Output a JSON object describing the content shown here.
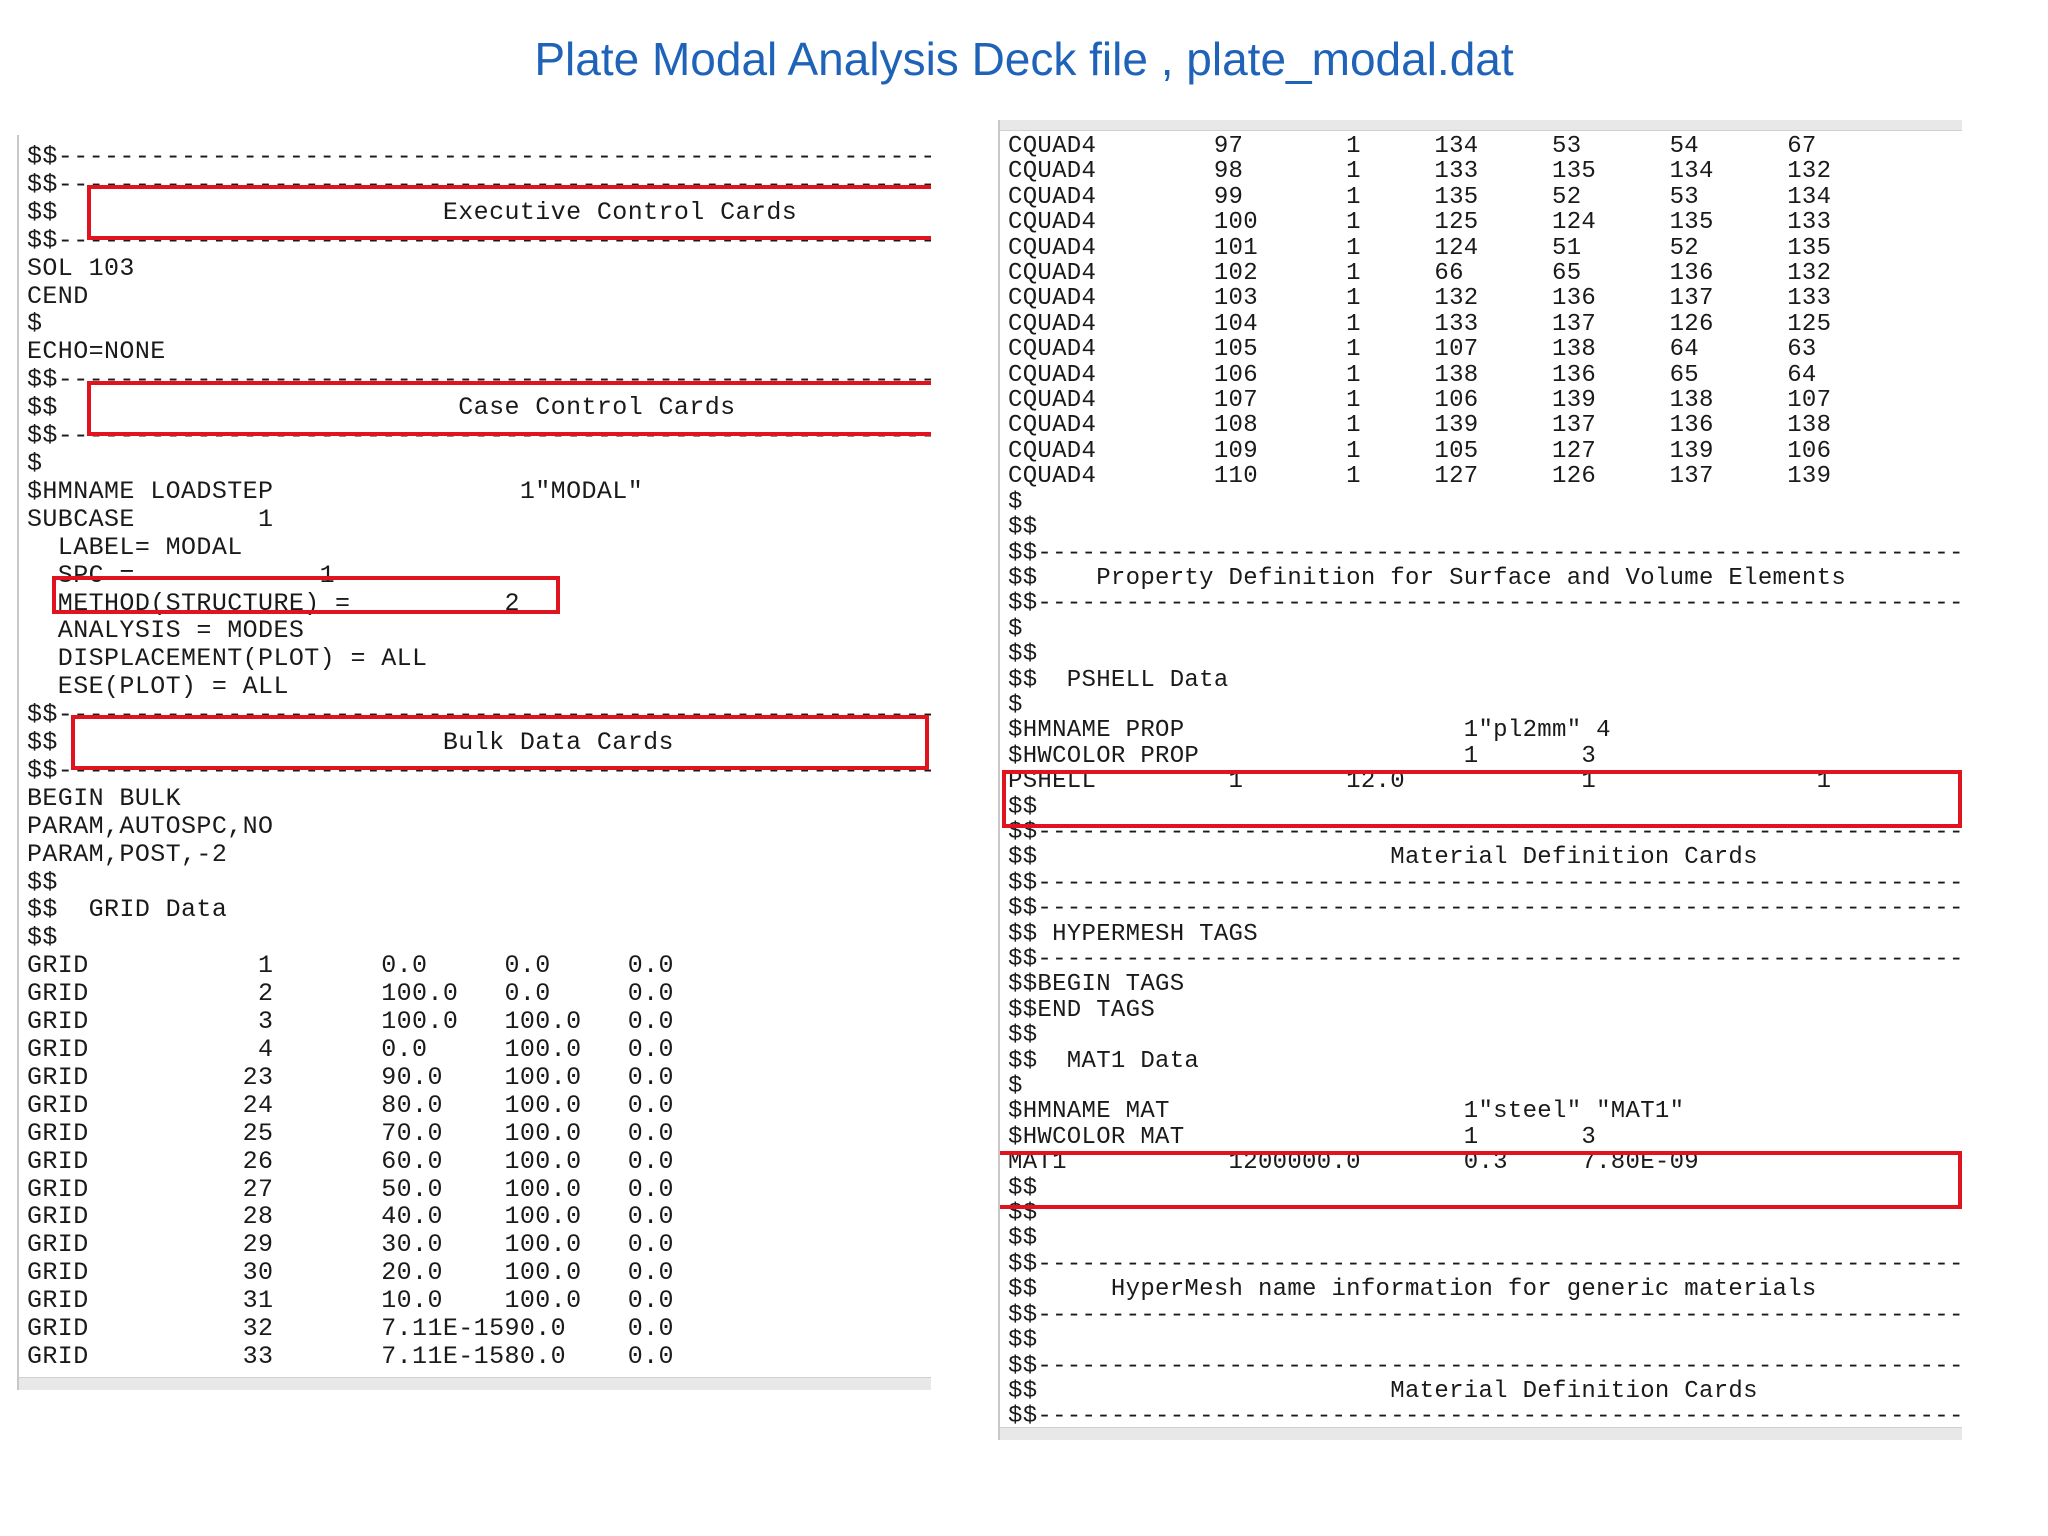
{
  "title": "Plate Modal Analysis Deck file , plate_modal.dat",
  "left_lines": [
    "$$------------------------------------------------------------------------",
    "$$------------------------------------------------------------------------",
    "$$                         Executive Control Cards",
    "$$------------------------------------------------------------------------",
    "SOL 103",
    "CEND",
    "$",
    "ECHO=NONE",
    "$$------------------------------------------------------------------------",
    "$$                          Case Control Cards",
    "$$------------------------------------------------------------------------",
    "$",
    "$HMNAME LOADSTEP                1\"MODAL\"",
    "SUBCASE        1",
    "  LABEL= MODAL",
    "  SPC =            1",
    "  METHOD(STRUCTURE) =          2",
    "  ANALYSIS = MODES",
    "  DISPLACEMENT(PLOT) = ALL",
    "  ESE(PLOT) = ALL",
    "$$------------------------------------------------------------------------",
    "$$                         Bulk Data Cards",
    "$$------------------------------------------------------------------------",
    "BEGIN BULK",
    "PARAM,AUTOSPC,NO",
    "PARAM,POST,-2",
    "$$",
    "$$  GRID Data",
    "$$",
    "GRID           1       0.0     0.0     0.0",
    "GRID           2       100.0   0.0     0.0",
    "GRID           3       100.0   100.0   0.0",
    "GRID           4       0.0     100.0   0.0",
    "GRID          23       90.0    100.0   0.0",
    "GRID          24       80.0    100.0   0.0",
    "GRID          25       70.0    100.0   0.0",
    "GRID          26       60.0    100.0   0.0",
    "GRID          27       50.0    100.0   0.0",
    "GRID          28       40.0    100.0   0.0",
    "GRID          29       30.0    100.0   0.0",
    "GRID          30       20.0    100.0   0.0",
    "GRID          31       10.0    100.0   0.0",
    "GRID          32       7.11E-1590.0    0.0",
    "GRID          33       7.11E-1580.0    0.0"
  ],
  "right_lines": [
    "CQUAD4        97       1     134     53      54      67",
    "CQUAD4        98       1     133     135     134     132",
    "CQUAD4        99       1     135     52      53      134",
    "CQUAD4        100      1     125     124     135     133",
    "CQUAD4        101      1     124     51      52      135",
    "CQUAD4        102      1     66      65      136     132",
    "CQUAD4        103      1     132     136     137     133",
    "CQUAD4        104      1     133     137     126     125",
    "CQUAD4        105      1     107     138     64      63",
    "CQUAD4        106      1     138     136     65      64",
    "CQUAD4        107      1     106     139     138     107",
    "CQUAD4        108      1     139     137     136     138",
    "CQUAD4        109      1     105     127     139     106",
    "CQUAD4        110      1     127     126     137     139",
    "$",
    "$$",
    "$$------------------------------------------------------------------------",
    "$$    Property Definition for Surface and Volume Elements",
    "$$------------------------------------------------------------------------",
    "$",
    "$$",
    "$$  PSHELL Data",
    "$",
    "$HMNAME PROP                   1\"pl2mm\" 4",
    "$HWCOLOR PROP                  1       3",
    "PSHELL         1       12.0            1               1",
    "$$",
    "$$------------------------------------------------------------------------",
    "$$                        Material Definition Cards",
    "$$------------------------------------------------------------------------",
    "$$------------------------------------------------------------------------",
    "$$ HYPERMESH TAGS",
    "$$------------------------------------------------------------------------",
    "$$BEGIN TAGS",
    "$$END TAGS",
    "$$",
    "$$  MAT1 Data",
    "$",
    "$HMNAME MAT                    1\"steel\" \"MAT1\"",
    "$HWCOLOR MAT                   1       3",
    "MAT1           1200000.0       0.3     7.80E-09",
    "$$",
    "$$",
    "$$",
    "$$------------------------------------------------------------------------",
    "$$     HyperMesh name information for generic materials",
    "$$------------------------------------------------------------------------",
    "$$",
    "$$------------------------------------------------------------------------",
    "$$                        Material Definition Cards",
    "$$------------------------------------------------------------------------"
  ],
  "highlight_color": "#e0141e",
  "title_color": "#1f63b8"
}
